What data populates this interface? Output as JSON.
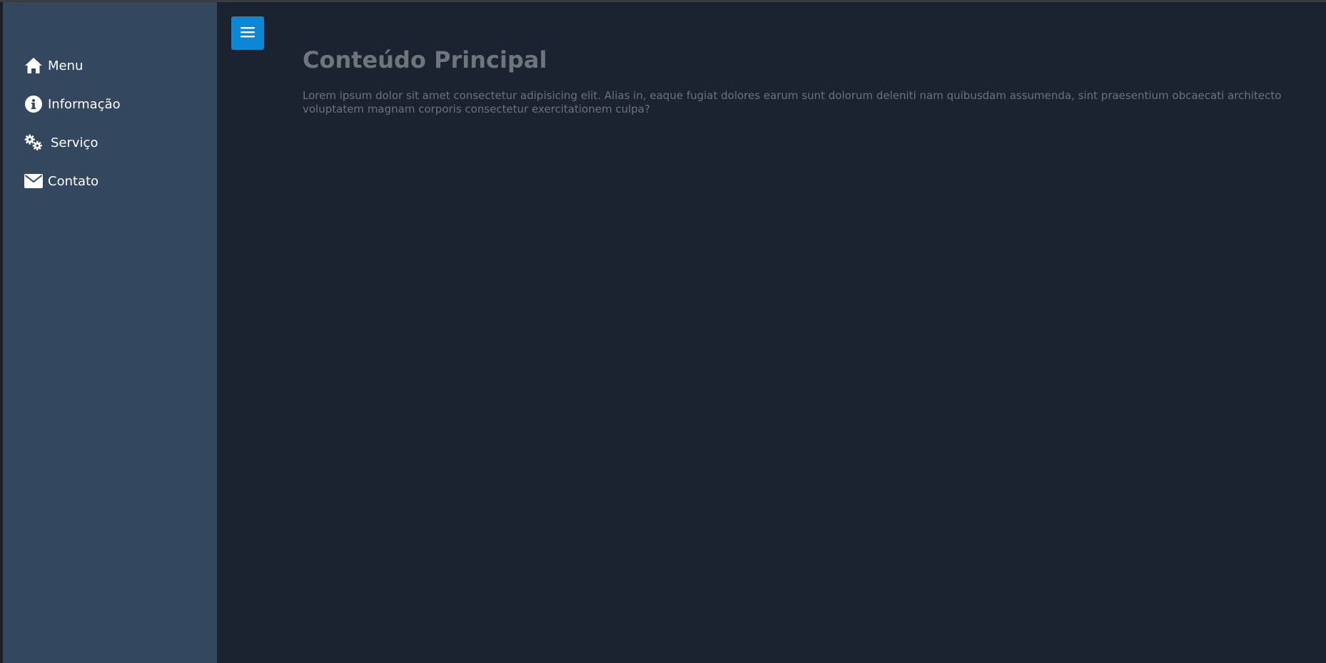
{
  "sidebar": {
    "items": [
      {
        "label": "Menu",
        "icon": "home-icon"
      },
      {
        "label": "Informação",
        "icon": "info-icon"
      },
      {
        "label": "Serviço",
        "icon": "gears-icon"
      },
      {
        "label": "Contato",
        "icon": "envelope-icon"
      }
    ]
  },
  "main": {
    "toggle_icon": "hamburger-icon",
    "title": "Conteúdo Principal",
    "paragraph": "Lorem ipsum dolor sit amet consectetur adipisicing elit. Alias in, eaque fugiat dolores earum sunt dolorum deleniti nam quibusdam assumenda, sint praesentium obcaecati architecto voluptatem magnam corporis consectetur exercitationem culpa?"
  },
  "colors": {
    "sidebar_bg": "#33475f",
    "main_bg": "#1b2230",
    "toggle_button": "#0b87d6",
    "title_text": "#6f757c",
    "body_text": "#6c727a"
  }
}
